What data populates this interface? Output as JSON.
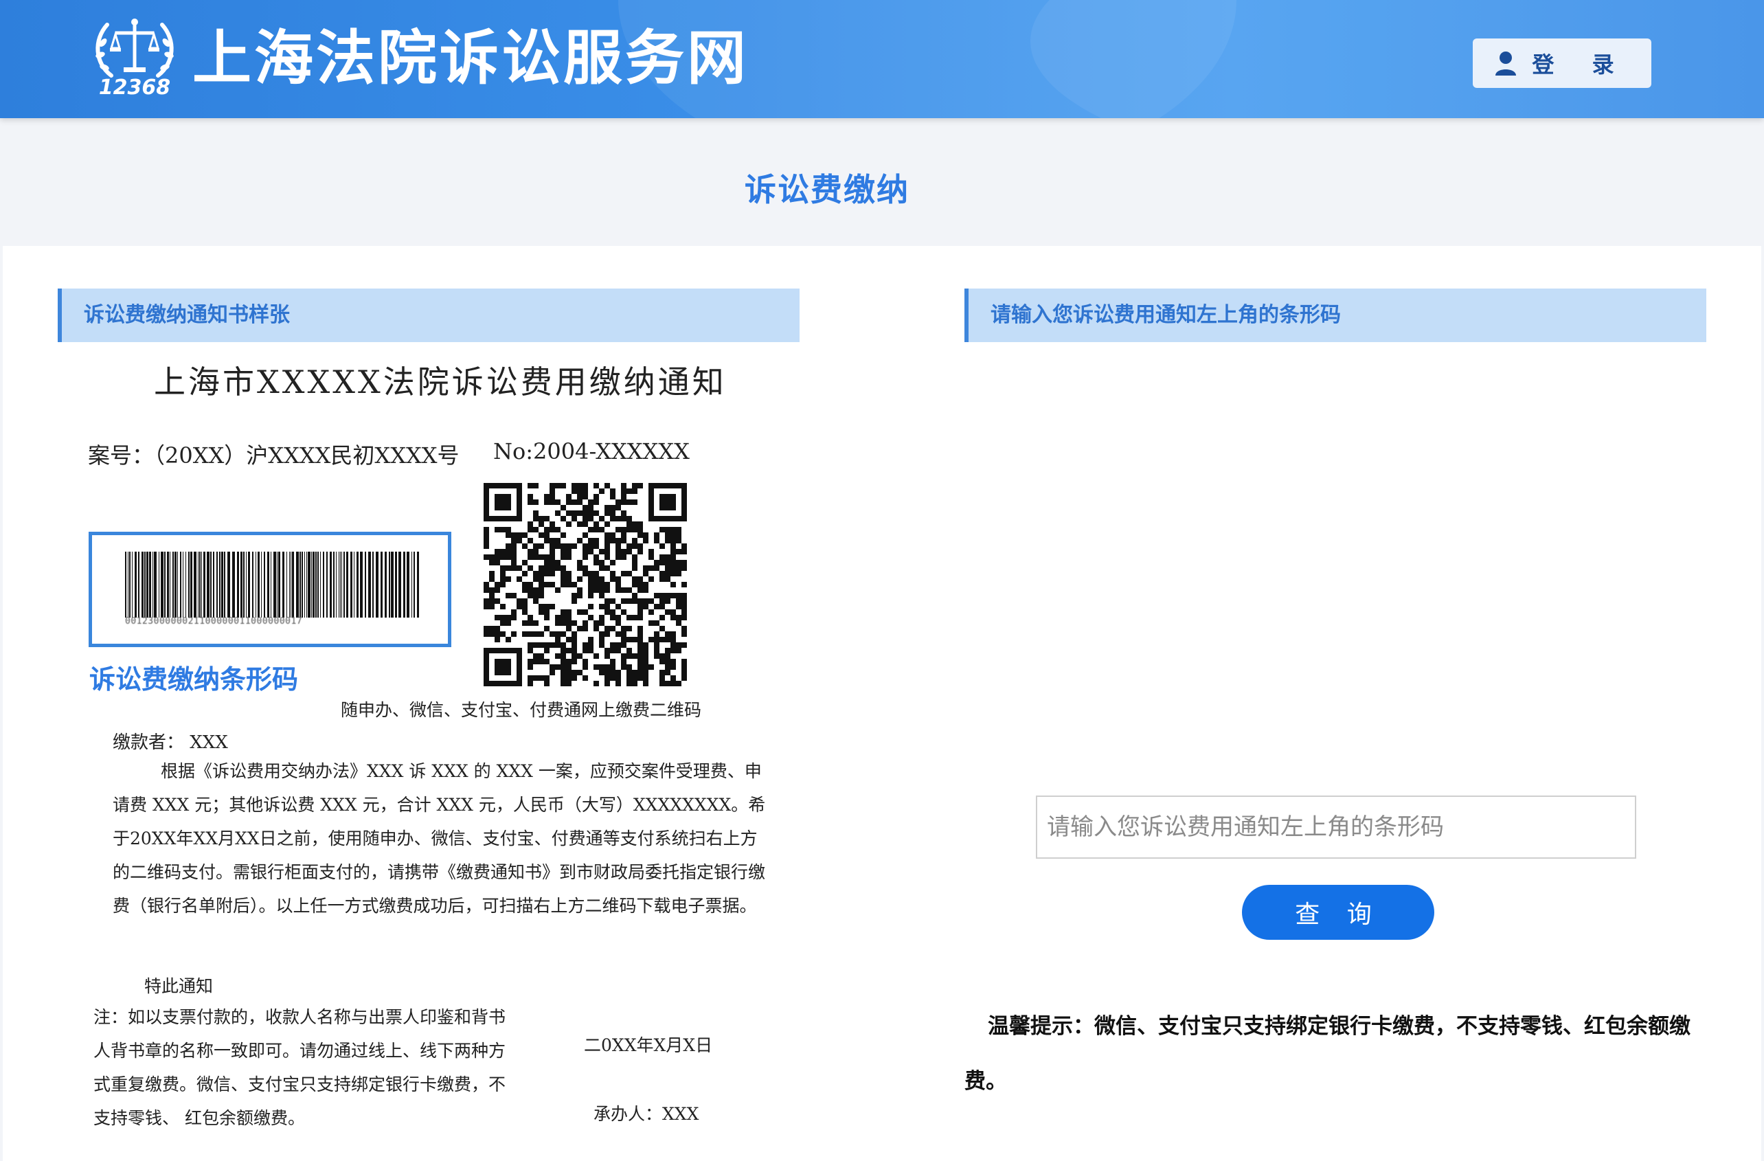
{
  "header": {
    "logo_text": "12368",
    "site_title": "上海法院诉讼服务网",
    "login_label": "登 录"
  },
  "page_title": "诉讼费缴纳",
  "left_panel": {
    "heading": "诉讼费缴纳通知书样张",
    "document": {
      "title": "上海市XXXXX法院诉讼费用缴纳通知",
      "case_no": "案号：（20XX）沪XXXX民初XXXX号",
      "serial_no": "No:2004-XXXXXX",
      "barcode_label": "诉讼费缴纳条形码",
      "barcode_number": "0012300000021100000011000000017",
      "qr_caption": "随申办、微信、支付宝、付费通网上缴费二维码",
      "payer": "缴款者：  XXX",
      "body": "根据《诉讼费用交纳办法》XXX 诉 XXX 的 XXX 一案，应预交案件受理费、申请费 XXX 元；其他诉讼费 XXX 元，合计 XXX 元，人民币（大写）XXXXXXXX。希于20XX年XX月XX日之前，使用随申办、微信、支付宝、付费通等支付系统扫右上方的二维码支付。需银行柜面支付的，请携带《缴费通知书》到市财政局委托指定银行缴费（银行名单附后）。以上任一方式缴费成功后，可扫描右上方二维码下载电子票据。",
      "special_notice": "特此通知",
      "note": "注：如以支票付款的，收款人名称与出票人印鉴和背书人背书章的名称一致即可。请勿通过线上、线下两种方式重复缴费。微信、支付宝只支持绑定银行卡缴费，不支持零钱、 红包余额缴费。",
      "date": "二0XX年X月X日",
      "handler": "承办人：XXX"
    }
  },
  "right_panel": {
    "heading": "请输入您诉讼费用通知左上角的条形码",
    "input_placeholder": "请输入您诉讼费用通知左上角的条形码",
    "input_value": "",
    "query_label": "查 询",
    "tip": "温馨提示：微信、支付宝只支持绑定银行卡缴费，不支持零钱、红包余额缴费。"
  },
  "icons": {
    "logo": "court-emblem-icon",
    "login": "user-icon",
    "barcode": "barcode-icon",
    "qr": "qr-code-icon"
  },
  "colors": {
    "header_blue": "#3a8ee8",
    "accent_blue": "#2f7be2",
    "panel_header_bg": "#c3ddf8",
    "button_blue": "#1471e6"
  }
}
